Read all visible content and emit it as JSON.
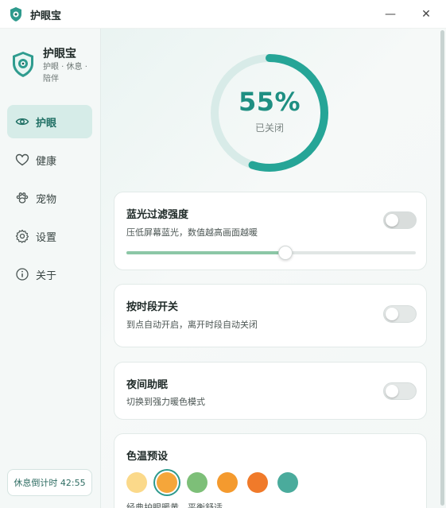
{
  "window": {
    "title": "护眼宝",
    "minimize_glyph": "—",
    "close_glyph": "✕"
  },
  "sidebar": {
    "brand_name": "护眼宝",
    "brand_tagline": "护眼 · 休息 · 陪伴",
    "items": [
      {
        "label": "护眼",
        "icon": "eye-icon",
        "active": true
      },
      {
        "label": "健康",
        "icon": "heart-icon",
        "active": false
      },
      {
        "label": "宠物",
        "icon": "paw-icon",
        "active": false
      },
      {
        "label": "设置",
        "icon": "gear-icon",
        "active": false
      },
      {
        "label": "关于",
        "icon": "info-icon",
        "active": false
      }
    ],
    "break_timer": "休息倒计时 42:55"
  },
  "status_ring": {
    "percent_text": "55%",
    "percent_value": 55,
    "status": "已关闭"
  },
  "cards": {
    "blue_light": {
      "title": "蓝光过滤强度",
      "description": "压低屏幕蓝光，数值越高画面越暖",
      "enabled": false,
      "slider_value": 55
    },
    "schedule": {
      "title": "按时段开关",
      "description": "到点自动开启，离开时段自动关闭",
      "enabled": false
    },
    "night": {
      "title": "夜间助眠",
      "description": "切换到强力暖色模式",
      "enabled": false
    },
    "presets": {
      "title": "色温预设",
      "description": "经典护眼暖黄，平衡舒适",
      "swatches": [
        "#fbd98a",
        "#f5a63a",
        "#7dbf78",
        "#f49a2e",
        "#f07a2a",
        "#4aab9c"
      ],
      "selected_index": 1
    }
  },
  "colors": {
    "accent": "#26a597",
    "accent_dark": "#1e8f82",
    "ring_track": "#d8ebe8"
  }
}
